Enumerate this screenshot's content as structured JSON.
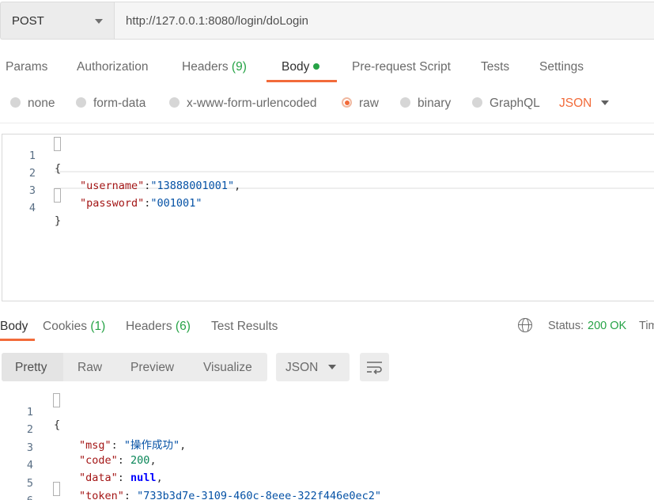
{
  "request": {
    "method": "POST",
    "url": "http://127.0.0.1:8080/login/doLogin"
  },
  "request_tabs": [
    {
      "label": "Params"
    },
    {
      "label": "Authorization"
    },
    {
      "label": "Headers",
      "count": "(9)"
    },
    {
      "label": "Body",
      "active": true,
      "dot": true
    },
    {
      "label": "Pre-request Script"
    },
    {
      "label": "Tests"
    },
    {
      "label": "Settings"
    }
  ],
  "body_types": {
    "options": [
      "none",
      "form-data",
      "x-www-form-urlencoded",
      "raw",
      "binary",
      "GraphQL"
    ],
    "selected": "raw",
    "format": "JSON"
  },
  "request_body": {
    "line_numbers": [
      "1",
      "2",
      "3",
      "4"
    ],
    "open_brace": "{",
    "close_brace": "}",
    "fields": [
      {
        "key": "\"username\"",
        "sep": ":",
        "value": "\"13888001001\"",
        "tail": ","
      },
      {
        "key": "\"password\"",
        "sep": ":",
        "value": "\"001001\"",
        "tail": ""
      }
    ]
  },
  "response_tabs": [
    {
      "label": "Body",
      "active": true
    },
    {
      "label": "Cookies",
      "count": "(1)"
    },
    {
      "label": "Headers",
      "count": "(6)"
    },
    {
      "label": "Test Results"
    }
  ],
  "response_status": {
    "label": "Status:",
    "value": "200 OK",
    "time_label": "Tim"
  },
  "view_tabs": [
    "Pretty",
    "Raw",
    "Preview",
    "Visualize"
  ],
  "response_format": "JSON",
  "response_body": {
    "line_numbers": [
      "1",
      "2",
      "3",
      "4",
      "5",
      "6"
    ],
    "open_brace": "{",
    "close_brace": "}",
    "fields": [
      {
        "key": "\"msg\"",
        "value": "\"操作成功\"",
        "type": "string"
      },
      {
        "key": "\"code\"",
        "value": "200",
        "type": "number"
      },
      {
        "key": "\"data\"",
        "value": "null",
        "type": "keyword"
      },
      {
        "key": "\"token\"",
        "value": "\"733b3d7e-3109-460c-8eee-322f446e0ec2\"",
        "type": "string"
      }
    ]
  },
  "colors": {
    "accent": "#f26b3a",
    "success": "#26a346",
    "json_key": "#a31515",
    "json_string": "#0451a5",
    "json_number": "#098658",
    "json_keyword": "#0000ff"
  }
}
